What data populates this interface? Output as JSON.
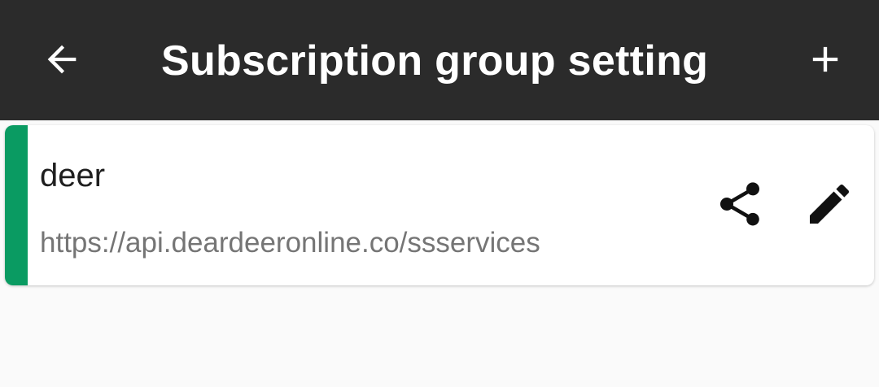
{
  "toolbar": {
    "title": "Subscription group setting",
    "back_icon": "arrow-back-icon",
    "add_icon": "plus-icon",
    "background_color": "#2b2b2b"
  },
  "groups": [
    {
      "name": "deer",
      "url": "https://api.deardeeronline.co/ssservices",
      "accent_color": "#0a9b62",
      "share_icon": "share-icon",
      "edit_icon": "pencil-icon"
    }
  ]
}
